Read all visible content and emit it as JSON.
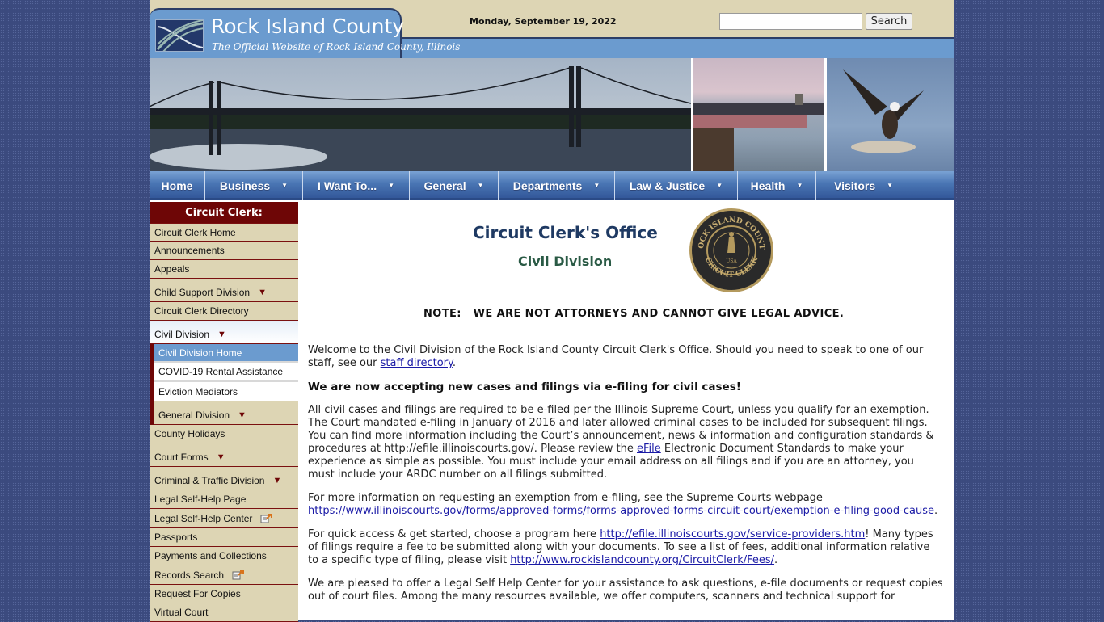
{
  "header": {
    "site_title": "Rock Island County",
    "tagline": "The Official Website of Rock Island County, Illinois",
    "date": "Monday, September 19, 2022",
    "search": {
      "placeholder": "",
      "value": "",
      "button_label": "Search"
    }
  },
  "banner": {
    "images": [
      "bridge-photo",
      "lock-and-dam-photo",
      "bald-eagle-photo"
    ]
  },
  "nav": {
    "items": [
      {
        "label": "Home",
        "has_dropdown": false
      },
      {
        "label": "Business",
        "has_dropdown": true
      },
      {
        "label": "I Want To...",
        "has_dropdown": true
      },
      {
        "label": "General",
        "has_dropdown": true
      },
      {
        "label": "Departments",
        "has_dropdown": true
      },
      {
        "label": "Law & Justice",
        "has_dropdown": true
      },
      {
        "label": "Health",
        "has_dropdown": true
      },
      {
        "label": "Visitors",
        "has_dropdown": true
      }
    ]
  },
  "sidebar": {
    "heading": "Circuit Clerk:",
    "items": [
      {
        "label": "Circuit Clerk Home"
      },
      {
        "label": "Announcements"
      },
      {
        "label": "Appeals"
      },
      {
        "label": "Child Support Division",
        "dropdown": true
      },
      {
        "label": "Circuit Clerk Directory"
      },
      {
        "label": "Civil Division",
        "dropdown": true,
        "expanded": true
      },
      {
        "label": "County Holidays"
      },
      {
        "label": "Court Forms",
        "dropdown": true
      },
      {
        "label": "Criminal & Traffic Division",
        "dropdown": true
      },
      {
        "label": "Legal Self-Help Page"
      },
      {
        "label": "Legal Self-Help Center",
        "external": true
      },
      {
        "label": "Passports"
      },
      {
        "label": "Payments and Collections"
      },
      {
        "label": "Records Search",
        "external": true
      },
      {
        "label": "Request For Copies"
      },
      {
        "label": "Virtual Court"
      }
    ],
    "civil_subitems": [
      {
        "label": "Civil Division Home",
        "active": true
      },
      {
        "label": "COVID-19 Rental Assistance"
      },
      {
        "label": "Eviction Mediators"
      },
      {
        "label": "General Division",
        "dropdown": true
      }
    ]
  },
  "content": {
    "title": "Circuit Clerk's Office",
    "subtitle": "Civil Division",
    "seal_alt": "Rock Island County Circuit Clerk seal",
    "note": "NOTE:   WE ARE NOT ATTORNEYS AND CANNOT GIVE LEGAL ADVICE.",
    "p1_before": "Welcome to the Civil Division of the Rock Island County Circuit Clerk's Office. Should you need to speak to one of our staff, see our ",
    "p1_link": "staff directory",
    "p1_after": ".",
    "p2_bold": "We are now accepting new cases and filings via e-filing for civil cases!",
    "p3_before": "All civil cases and filings are required to be e-filed per the Illinois Supreme Court, unless you qualify for an exemption. The Court mandated e-filing in January of 2016 and later allowed criminal cases to be included for subsequent filings. You can find more information including the Court’s announcement, news & information and configuration standards & procedures at http://efile.illinoiscourts.gov/. Please review the ",
    "p3_link": "eFile",
    "p3_after": " Electronic Document Standards to make your experience as simple as possible. You must include your email address on all filings and if you are an attorney, you must include your ARDC number on all filings submitted.",
    "p4_before": "For more information on requesting an exemption from e-filing, see the Supreme Courts webpage ",
    "p4_link": "https://www.illinoiscourts.gov/forms/approved-forms/forms-approved-forms-circuit-court/exemption-e-filing-good-cause",
    "p4_after": ".",
    "p5_before": "For quick access & get started, choose a program here ",
    "p5_link1": "http://efile.illinoiscourts.gov/service-providers.htm",
    "p5_mid": "! Many types of filings require a fee to be submitted along with your documents. To see a list of fees, additional information relative to a specific type of filing, please visit ",
    "p5_link2": "http://www.rockislandcounty.org/CircuitClerk/Fees/",
    "p5_after": ".",
    "p6": "We are pleased to offer a Legal Self Help Center for your assistance to ask questions, e-file documents or request copies out of court files. Among the many resources available, we offer computers, scanners and technical support for"
  },
  "colors": {
    "background": "#3b4a7e",
    "header_tan": "#ddd5b4",
    "header_blue": "#6b9bcf",
    "nav_blue": "#4a76b4",
    "sidebar_maroon": "#6e0606",
    "link": "#1a1aa6",
    "title_navy": "#1f3a63",
    "subtitle_green": "#2a5a45"
  }
}
